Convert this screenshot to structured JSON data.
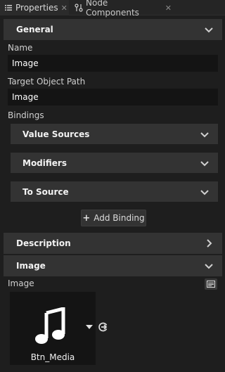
{
  "tabs": [
    {
      "label": "Properties",
      "icon": "list-icon",
      "active": true
    },
    {
      "label": "Node Components",
      "icon": "node-components-icon",
      "active": false
    }
  ],
  "general": {
    "header": "General",
    "name_label": "Name",
    "name_value": "Image",
    "target_path_label": "Target Object Path",
    "target_path_value": "Image",
    "bindings_label": "Bindings",
    "sub_sections": [
      "Value Sources",
      "Modifiers",
      "To Source"
    ],
    "add_binding_label": "Add Binding"
  },
  "description": {
    "header": "Description"
  },
  "image_section": {
    "header": "Image",
    "image_label": "Image",
    "image_name": "Btn_Media"
  }
}
